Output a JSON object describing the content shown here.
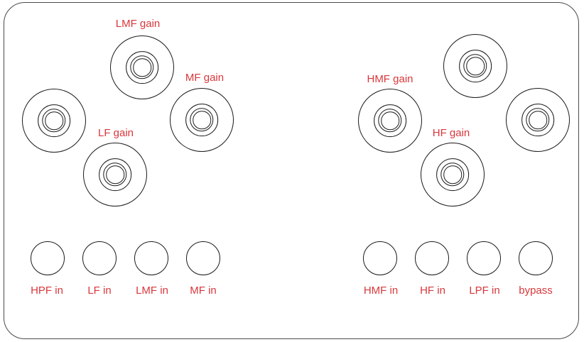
{
  "colors": {
    "label": "#d9373b",
    "outline": "#1a1a1a"
  },
  "knobs": {
    "lmf_gain": "LMF gain",
    "mf_gain": "MF gain",
    "lf_gain": "LF gain",
    "hmf_gain": "HMF gain",
    "hf_gain": "HF gain"
  },
  "buttons": {
    "hpf_in": "HPF in",
    "lf_in": "LF in",
    "lmf_in": "LMF in",
    "mf_in": "MF in",
    "hmf_in": "HMF in",
    "hf_in": "HF in",
    "lpf_in": "LPF in",
    "bypass": "bypass"
  }
}
